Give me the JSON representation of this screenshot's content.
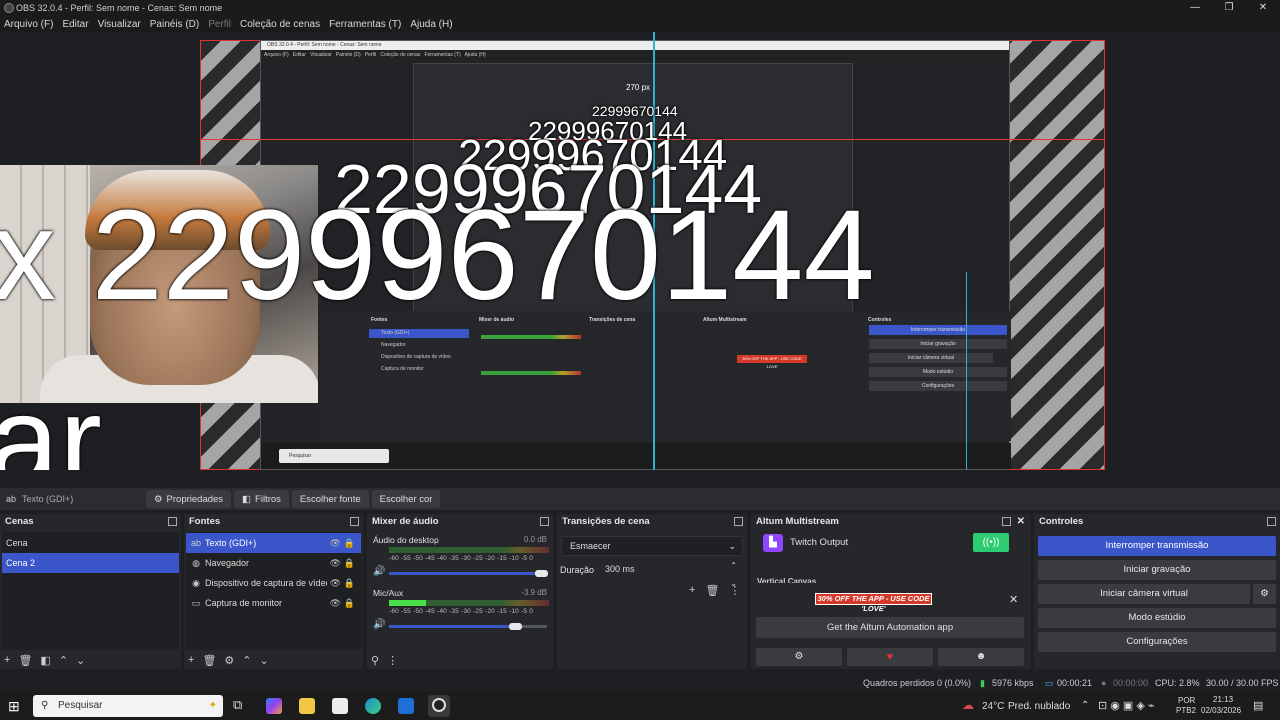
{
  "window": {
    "title": "OBS 32.0.4 - Perfil: Sem nome - Cenas: Sem nome",
    "controls": [
      "—",
      "❐",
      "✕"
    ]
  },
  "menu": [
    "Arquivo (F)",
    "Editar",
    "Visualizar",
    "Painéis (D)",
    "Perfil",
    "Coleção de cenas",
    "Ferramentas (T)",
    "Ajuda (H)"
  ],
  "preview": {
    "overlay_text_large": "x 22999670144",
    "overlay_text_2": "22999670144",
    "overlay_text_3": "22999670144",
    "overlay_text_4": "22999670144",
    "overlay_text_5": "22999670144",
    "overlay_text_bottom": "ar",
    "inner_size_label": "270 px"
  },
  "source_toolbar": {
    "selected_source": "Texto (GDI+)",
    "buttons": [
      "Propriedades",
      "Filtros",
      "Escolher fonte",
      "Escolher cor"
    ]
  },
  "docks": {
    "scenes": {
      "title": "Cenas",
      "items": [
        "Cena",
        "Cena 2"
      ]
    },
    "sources": {
      "title": "Fontes",
      "items": [
        "Texto (GDI+)",
        "Navegador",
        "Dispositivo de captura de vídeo",
        "Captura de monitor"
      ]
    },
    "mixer": {
      "title": "Mixer de áudio",
      "channels": [
        {
          "name": "Áudio do desktop",
          "db": "0.0 dB"
        },
        {
          "name": "Mic/Aux",
          "db": "-3.9 dB"
        }
      ],
      "scale": "-60 -55 -50 -45 -40 -35 -30 -25 -20 -15 -10 -5 0"
    },
    "transitions": {
      "title": "Transições de cena",
      "selected": "Esmaecer",
      "duration_label": "Duração",
      "duration_value": "300 ms"
    },
    "multistream": {
      "title": "Altum Multistream",
      "output": "Twitch Output",
      "section_label": "Vertical Canvas",
      "promo": "30% OFF THE APP - USE CODE 'LOVE'",
      "get_app": "Get the Altum Automation app"
    },
    "controls": {
      "title": "Controles",
      "buttons": [
        "Interromper transmissão",
        "Iniciar gravação",
        "Iniciar câmera virtual",
        "Modo estúdio",
        "Configurações"
      ]
    }
  },
  "status": {
    "dropped": "Quadros perdidos 0 (0.0%)",
    "bitrate": "5976 kbps",
    "stream_time": "00:00:21",
    "rec_time": "00:00:00",
    "cpu": "CPU: 2.8%",
    "fps": "30.00 / 30.00 FPS"
  },
  "taskbar": {
    "search_placeholder": "Pesquisar",
    "weather": "24°C",
    "weather_desc": "Pred. nublado",
    "lang": "POR",
    "lang2": "PTB2",
    "time": "21:13",
    "date": "02/03/2026"
  },
  "colors": {
    "accent": "#3b56c9",
    "twitch": "#9146ff",
    "live_green": "#2ecc71"
  }
}
